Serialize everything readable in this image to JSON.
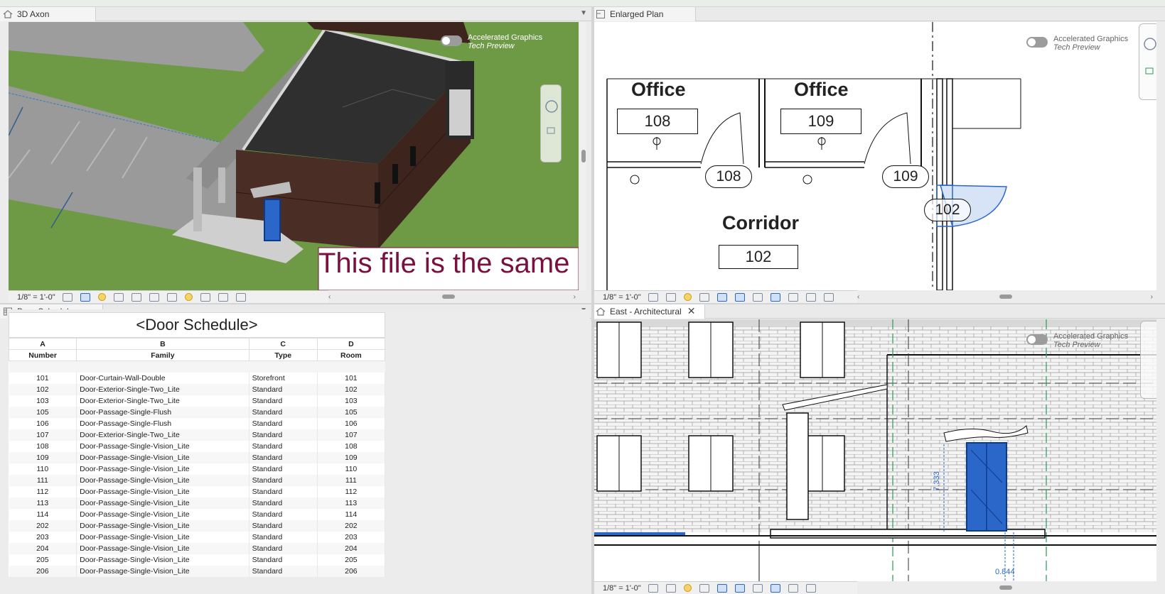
{
  "views": {
    "axon": {
      "tab": "3D Axon",
      "scale": "1/8\" = 1'-0\"",
      "overlay_text": "This file is the same",
      "agt_line1": "Accelerated Graphics",
      "agt_line2": "Tech Preview"
    },
    "plan": {
      "tab": "Enlarged Plan",
      "scale": "1/8\" = 1'-0\"",
      "agt_line1": "Accelerated Graphics",
      "agt_line2": "Tech Preview",
      "rooms": [
        {
          "name": "Office",
          "number": "108"
        },
        {
          "name": "Office",
          "number": "109"
        },
        {
          "name": "Corridor",
          "number": "102"
        }
      ],
      "door_tags": [
        "108",
        "109",
        "102"
      ]
    },
    "schedule": {
      "tab": "Door Schedule"
    },
    "east": {
      "tab": "East - Architectural",
      "scale": "1/8\" = 1'-0\"",
      "agt_line1": "Accelerated Graphics",
      "agt_line2": "Tech Preview",
      "dim_height": "7.333",
      "dim_width": "0.844"
    }
  },
  "door_schedule": {
    "title": "<Door Schedule>",
    "column_letters": [
      "A",
      "B",
      "C",
      "D"
    ],
    "column_headers": [
      "Number",
      "Family",
      "Type",
      "Room"
    ],
    "rows": [
      [
        "101",
        "Door-Curtain-Wall-Double",
        "Storefront",
        "101"
      ],
      [
        "102",
        "Door-Exterior-Single-Two_Lite",
        "Standard",
        "102"
      ],
      [
        "103",
        "Door-Exterior-Single-Two_Lite",
        "Standard",
        "103"
      ],
      [
        "105",
        "Door-Passage-Single-Flush",
        "Standard",
        "105"
      ],
      [
        "106",
        "Door-Passage-Single-Flush",
        "Standard",
        "106"
      ],
      [
        "107",
        "Door-Exterior-Single-Two_Lite",
        "Standard",
        "107"
      ],
      [
        "108",
        "Door-Passage-Single-Vision_Lite",
        "Standard",
        "108"
      ],
      [
        "109",
        "Door-Passage-Single-Vision_Lite",
        "Standard",
        "109"
      ],
      [
        "110",
        "Door-Passage-Single-Vision_Lite",
        "Standard",
        "110"
      ],
      [
        "111",
        "Door-Passage-Single-Vision_Lite",
        "Standard",
        "111"
      ],
      [
        "112",
        "Door-Passage-Single-Vision_Lite",
        "Standard",
        "112"
      ],
      [
        "113",
        "Door-Passage-Single-Vision_Lite",
        "Standard",
        "113"
      ],
      [
        "114",
        "Door-Passage-Single-Vision_Lite",
        "Standard",
        "114"
      ],
      [
        "202",
        "Door-Passage-Single-Vision_Lite",
        "Standard",
        "202"
      ],
      [
        "203",
        "Door-Passage-Single-Vision_Lite",
        "Standard",
        "203"
      ],
      [
        "204",
        "Door-Passage-Single-Vision_Lite",
        "Standard",
        "204"
      ],
      [
        "205",
        "Door-Passage-Single-Vision_Lite",
        "Standard",
        "205"
      ],
      [
        "206",
        "Door-Passage-Single-Vision_Lite",
        "Standard",
        "206"
      ]
    ]
  },
  "colors": {
    "ground": "#6e9a46",
    "roof": "#2f2f2f",
    "brick": "#4a2e25",
    "selection": "#2a67c9",
    "banner_text": "#7a1040"
  }
}
